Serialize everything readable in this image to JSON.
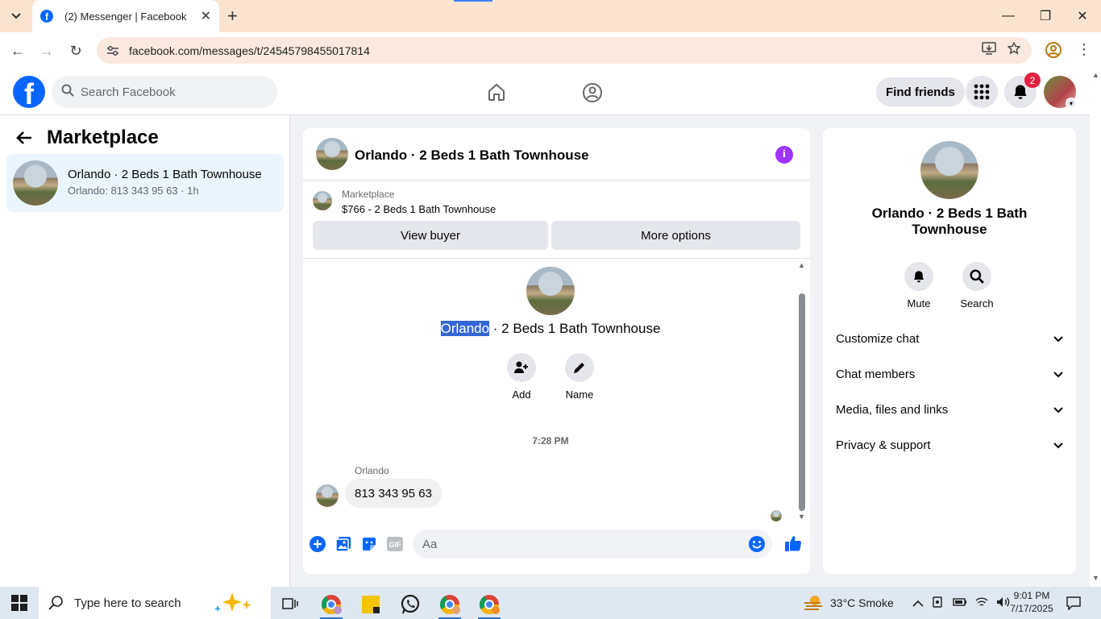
{
  "browser": {
    "tab_title": "(2) Messenger | Facebook",
    "url": "facebook.com/messages/t/24545798455017814"
  },
  "fb": {
    "search_placeholder": "Search Facebook",
    "find_friends": "Find friends",
    "notification_count": "2",
    "brand_color": "#0866ff"
  },
  "sidebar": {
    "title": "Marketplace",
    "conversations": [
      {
        "name": "Orlando · 2 Beds 1 Bath Townhouse",
        "preview": "Orlando: 813 343 95 63 · 1h"
      }
    ]
  },
  "chat": {
    "title": "Orlando · 2 Beds 1 Bath Townhouse",
    "marketplace_label": "Marketplace",
    "listing": "$766 - 2 Beds 1 Bath Townhouse",
    "view_buyer": "View buyer",
    "more_options": "More options",
    "intro_highlight": "Orlando",
    "intro_rest": " · 2 Beds 1 Bath Townhouse",
    "add_label": "Add",
    "name_label": "Name",
    "timestamp": "7:28 PM",
    "sender": "Orlando",
    "message": "813 343 95 63",
    "composer_placeholder": "Aa"
  },
  "info": {
    "name": "Orlando · 2 Beds 1 Bath Townhouse",
    "mute": "Mute",
    "search": "Search",
    "sections": [
      "Customize chat",
      "Chat members",
      "Media, files and links",
      "Privacy & support"
    ]
  },
  "taskbar": {
    "search_text": "Type here to search",
    "weather": "33°C  Smoke",
    "time": "9:01 PM",
    "date": "7/17/2025"
  }
}
